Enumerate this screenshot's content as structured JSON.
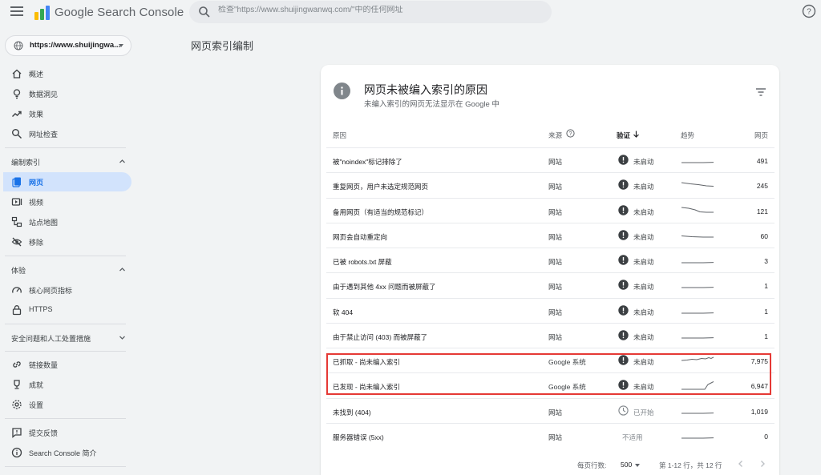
{
  "app": {
    "title": "Google Search Console"
  },
  "search": {
    "placeholder": "检查\"https://www.shuijingwanwq.com/\"中的任何网址"
  },
  "property": {
    "label": "https://www.shuijingwa..."
  },
  "sidebar": {
    "items": [
      {
        "label": "概述",
        "icon": "home-icon"
      },
      {
        "label": "数据洞见",
        "icon": "lightbulb-icon"
      },
      {
        "label": "效果",
        "icon": "trending-up-icon"
      },
      {
        "label": "网址检查",
        "icon": "search-icon"
      }
    ],
    "sections": [
      {
        "label": "编制索引",
        "expanded": true,
        "items": [
          {
            "label": "网页",
            "icon": "pages-icon",
            "active": true
          },
          {
            "label": "视频",
            "icon": "video-icon"
          },
          {
            "label": "站点地图",
            "icon": "sitemap-icon"
          },
          {
            "label": "移除",
            "icon": "visibility-off-icon"
          }
        ]
      },
      {
        "label": "体验",
        "expanded": true,
        "items": [
          {
            "label": "核心网页指标",
            "icon": "speed-icon"
          },
          {
            "label": "HTTPS",
            "icon": "lock-icon"
          }
        ]
      },
      {
        "label": "安全问题和人工处置措施",
        "expanded": false,
        "items": []
      }
    ],
    "bottom_items": [
      {
        "label": "链接数量",
        "icon": "link-icon"
      },
      {
        "label": "成就",
        "icon": "trophy-icon"
      },
      {
        "label": "设置",
        "icon": "gear-icon"
      }
    ],
    "footer_items": [
      {
        "label": "提交反馈",
        "icon": "feedback-icon"
      },
      {
        "label": "Search Console 简介",
        "icon": "info-icon"
      }
    ]
  },
  "page": {
    "title": "网页索引编制"
  },
  "card": {
    "title": "网页未被编入索引的原因",
    "subtitle": "未编入索引的网页无法显示在 Google 中"
  },
  "table": {
    "headers": {
      "reason": "原因",
      "source": "来源",
      "validation": "验证",
      "trend": "趋势",
      "pages": "网页"
    },
    "rows": [
      {
        "reason": "被\"noindex\"标记排除了",
        "source": "网站",
        "validation": "未启动",
        "status": "not-started",
        "pages": "491",
        "trend": "flat"
      },
      {
        "reason": "重复网页，用户未选定规范网页",
        "source": "网站",
        "validation": "未启动",
        "status": "not-started",
        "pages": "245",
        "trend": "decline"
      },
      {
        "reason": "备用网页（有适当的规范标记）",
        "source": "网站",
        "validation": "未启动",
        "status": "not-started",
        "pages": "121",
        "trend": "decline-step"
      },
      {
        "reason": "网页会自动重定向",
        "source": "网站",
        "validation": "未启动",
        "status": "not-started",
        "pages": "60",
        "trend": "slight-decline"
      },
      {
        "reason": "已被 robots.txt 屏蔽",
        "source": "网站",
        "validation": "未启动",
        "status": "not-started",
        "pages": "3",
        "trend": "flat"
      },
      {
        "reason": "由于遇到其他 4xx 问题而被屏蔽了",
        "source": "网站",
        "validation": "未启动",
        "status": "not-started",
        "pages": "1",
        "trend": "flat"
      },
      {
        "reason": "软 404",
        "source": "网站",
        "validation": "未启动",
        "status": "not-started",
        "pages": "1",
        "trend": "flat"
      },
      {
        "reason": "由于禁止访问 (403) 而被屏蔽了",
        "source": "网站",
        "validation": "未启动",
        "status": "not-started",
        "pages": "1",
        "trend": "flat"
      },
      {
        "reason": "已抓取 - 尚未编入索引",
        "source": "Google 系统",
        "validation": "未启动",
        "status": "not-started",
        "pages": "7,975",
        "trend": "rise-wavy"
      },
      {
        "reason": "已发现 - 尚未编入索引",
        "source": "Google 系统",
        "validation": "未启动",
        "status": "not-started",
        "pages": "6,947",
        "trend": "rise-late"
      },
      {
        "reason": "未找到 (404)",
        "source": "网站",
        "validation": "已开始",
        "status": "started",
        "pages": "1,019",
        "trend": "flat"
      },
      {
        "reason": "服务器错误 (5xx)",
        "source": "网站",
        "validation": "不适用",
        "status": "na",
        "pages": "0",
        "trend": "flat"
      }
    ]
  },
  "pagination": {
    "rows_per_page_label": "每页行数:",
    "rows_per_page": "500",
    "range": "第 1-12 行，共 12 行"
  },
  "colors": {
    "accent": "#1a73e8",
    "active_bg": "#d2e3fc",
    "highlight": "#e53935",
    "status_icon": "#3c4043"
  }
}
